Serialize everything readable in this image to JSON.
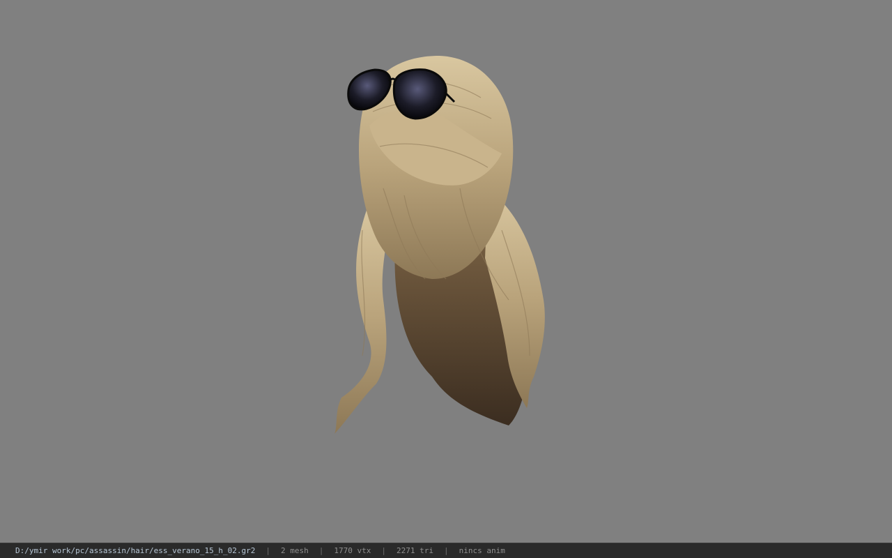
{
  "viewer": {
    "background_color": "#808080",
    "model_icon": "hair-mesh-with-sunglasses"
  },
  "statusbar": {
    "file_path": "D:/ymir work/pc/assassin/hair/ess_verano_15_h_02.gr2",
    "separator": "|",
    "mesh_count": "2 mesh",
    "vertex_count": "1770 vtx",
    "triangle_count": "2271 tri",
    "anim_status": "nincs anim"
  }
}
